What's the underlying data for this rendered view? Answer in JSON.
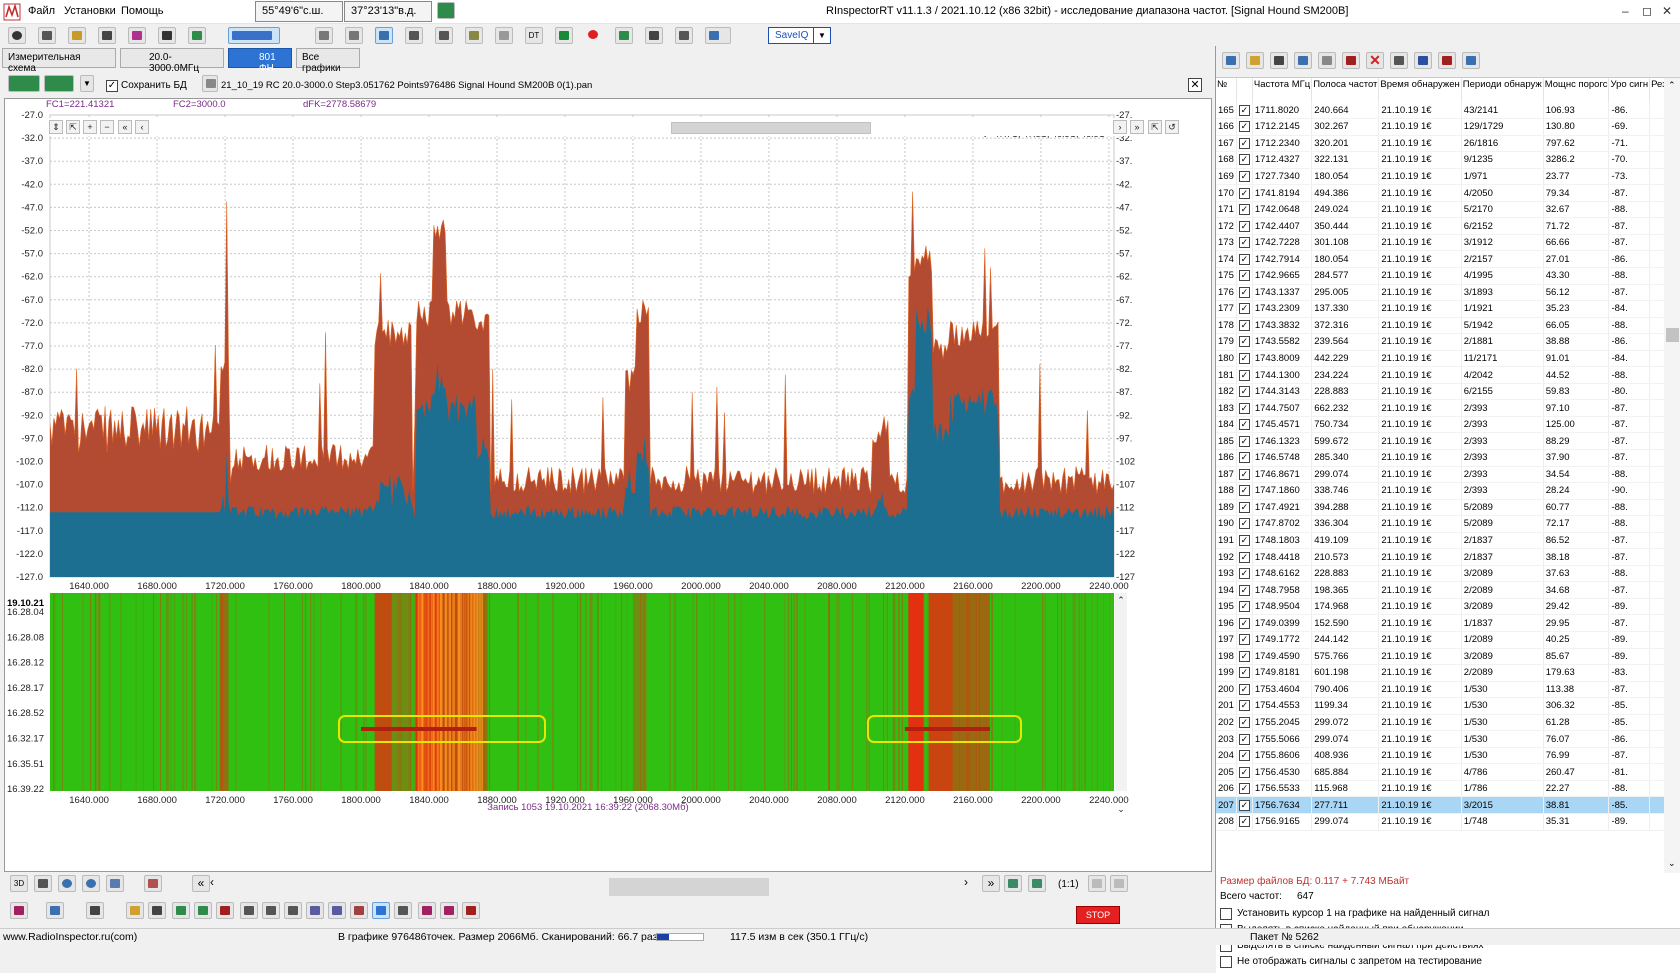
{
  "titlebar": {
    "title": "RInspectorRT v11.1.3 / 2021.10.12 (x86 32bit) - исследование диапазона частот. [Signal Hound SM200B]",
    "menu": [
      "Файл",
      "Установки",
      "Помощь"
    ],
    "lat": "55°49'6\"с.ш.",
    "lon": "37°23'13\"в.д."
  },
  "toolbar": {
    "saveiq_label": "SaveIQ"
  },
  "tabs": [
    {
      "label": "Измерительная схема"
    },
    {
      "label": "20.0-3000.0МГц"
    },
    {
      "label": "801 ФН"
    },
    {
      "label": "Все графики"
    }
  ],
  "filebar": {
    "save_db_label": "Сохранить БД",
    "filename": "21_10_19 RC 20.0-3000.0 Step3.051762 Points976486 Signal Hound SM200B 0(1).pan"
  },
  "spectrum": {
    "fc1": "FC1=221.41321",
    "fc2": "FC2=3000.0",
    "dfk": "dFK=2778.58679",
    "temperature": "t =47.7C, 47.8C, 46.5C, 46.8C",
    "y_ticks": [
      "-27.0",
      "-32.0",
      "-37.0",
      "-42.0",
      "-47.0",
      "-52.0",
      "-57.0",
      "-62.0",
      "-67.0",
      "-72.0",
      "-77.0",
      "-82.0",
      "-87.0",
      "-92.0",
      "-97.0",
      "-102.0",
      "-107.0",
      "-112.0",
      "-117.0",
      "-122.0",
      "-127.0"
    ],
    "y_ticks_right": [
      "-27.",
      "-32.",
      "-37.",
      "-42.",
      "-47.",
      "-52.",
      "-57.",
      "-62.",
      "-67.",
      "-72.",
      "-77.",
      "-82.",
      "-87.",
      "-92.",
      "-97.",
      "-102",
      "-107",
      "-112",
      "-117",
      "-122",
      "-127"
    ],
    "x_ticks": [
      "1640.000",
      "1680.000",
      "1720.000",
      "1760.000",
      "1800.000",
      "1840.000",
      "1880.000",
      "1920.000",
      "1960.000",
      "2000.000",
      "2040.000",
      "2080.000",
      "2120.000",
      "2160.000",
      "2200.000",
      "2240.000"
    ],
    "colors": {
      "peak": "#b34b32",
      "avg": "#1c6f91",
      "trace": "#e0641e"
    }
  },
  "waterfall": {
    "date": "19.10.21",
    "time_ticks": [
      "16.28.04",
      "16.28.08",
      "16.28.12",
      "16.28.17",
      "16.28.52",
      "16.32.17",
      "16.35.51",
      "16.39.22"
    ],
    "x_ticks": [
      "1640.000",
      "1680.000",
      "1720.000",
      "1760.000",
      "1800.000",
      "1840.000",
      "1880.000",
      "1920.000",
      "1960.000",
      "2000.000",
      "2040.000",
      "2080.000",
      "2120.000",
      "2160.000",
      "2200.000",
      "2240.000"
    ],
    "record": "Запись 1053 19.10.2021 16:39:22 (2068.30Мб)",
    "colors": {
      "bg": "#2fc012",
      "signal": "#e23010",
      "highlight": "#e9e600"
    }
  },
  "bottom": {
    "scale_label": "(1:1)",
    "stop_label": "STOP"
  },
  "status": {
    "site": "www.RadioInspector.ru(com)",
    "info": "В графике 976486точек.  Размер 2066Мб. Сканирований: 66.7 раз",
    "speed": "117.5 изм в сек (350.1 ГГц/с)",
    "packet": "Пакет № 5262"
  },
  "table": {
    "headers": [
      "№",
      "",
      "Частота МГц",
      "Полоса частот",
      "Время обнаружен",
      "Периоди обнаруж",
      "Мощнс порогс",
      "Уро сигн",
      "Результаты исследования сигн"
    ],
    "rows": [
      [
        "165",
        "1711.8020",
        "240.664",
        "21.10.19 1€",
        "43/2141",
        "106.93",
        "-86."
      ],
      [
        "166",
        "1712.2145",
        "302.267",
        "21.10.19 1€",
        "129/1729",
        "130.80",
        "-69."
      ],
      [
        "167",
        "1712.2340",
        "320.201",
        "21.10.19 1€",
        "26/1816",
        "797.62",
        "-71."
      ],
      [
        "168",
        "1712.4327",
        "322.131",
        "21.10.19 1€",
        "9/1235",
        "3286.2",
        "-70."
      ],
      [
        "169",
        "1727.7340",
        "180.054",
        "21.10.19 1€",
        "1/971",
        "23.77",
        "-73."
      ],
      [
        "170",
        "1741.8194",
        "494.386",
        "21.10.19 1€",
        "4/2050",
        "79.34",
        "-87."
      ],
      [
        "171",
        "1742.0648",
        "249.024",
        "21.10.19 1€",
        "5/2170",
        "32.67",
        "-88."
      ],
      [
        "172",
        "1742.4407",
        "350.444",
        "21.10.19 1€",
        "6/2152",
        "71.72",
        "-87."
      ],
      [
        "173",
        "1742.7228",
        "301.108",
        "21.10.19 1€",
        "3/1912",
        "66.66",
        "-87."
      ],
      [
        "174",
        "1742.7914",
        "180.054",
        "21.10.19 1€",
        "2/2157",
        "27.01",
        "-86."
      ],
      [
        "175",
        "1742.9665",
        "284.577",
        "21.10.19 1€",
        "4/1995",
        "43.30",
        "-88."
      ],
      [
        "176",
        "1743.1337",
        "295.005",
        "21.10.19 1€",
        "3/1893",
        "56.12",
        "-87."
      ],
      [
        "177",
        "1743.2309",
        "137.330",
        "21.10.19 1€",
        "1/1921",
        "35.23",
        "-84."
      ],
      [
        "178",
        "1743.3832",
        "372.316",
        "21.10.19 1€",
        "5/1942",
        "66.05",
        "-88."
      ],
      [
        "179",
        "1743.5582",
        "239.564",
        "21.10.19 1€",
        "2/1881",
        "38.88",
        "-86."
      ],
      [
        "180",
        "1743.8009",
        "442.229",
        "21.10.19 1€",
        "11/2171",
        "91.01",
        "-84."
      ],
      [
        "181",
        "1744.1300",
        "234.224",
        "21.10.19 1€",
        "4/2042",
        "44.52",
        "-88."
      ],
      [
        "182",
        "1744.3143",
        "228.883",
        "21.10.19 1€",
        "6/2155",
        "59.83",
        "-80."
      ],
      [
        "183",
        "1744.7507",
        "662.232",
        "21.10.19 1€",
        "2/393",
        "97.10",
        "-87."
      ],
      [
        "184",
        "1745.4571",
        "750.734",
        "21.10.19 1€",
        "2/393",
        "125.00",
        "-87."
      ],
      [
        "185",
        "1746.1323",
        "599.672",
        "21.10.19 1€",
        "2/393",
        "88.29",
        "-87."
      ],
      [
        "186",
        "1746.5748",
        "285.340",
        "21.10.19 1€",
        "2/393",
        "37.90",
        "-87."
      ],
      [
        "187",
        "1746.8671",
        "299.074",
        "21.10.19 1€",
        "2/393",
        "34.54",
        "-88."
      ],
      [
        "188",
        "1747.1860",
        "338.746",
        "21.10.19 1€",
        "2/393",
        "28.24",
        "-90."
      ],
      [
        "189",
        "1747.4921",
        "394.288",
        "21.10.19 1€",
        "5/2089",
        "60.77",
        "-88."
      ],
      [
        "190",
        "1747.8702",
        "336.304",
        "21.10.19 1€",
        "5/2089",
        "72.17",
        "-88."
      ],
      [
        "191",
        "1748.1803",
        "419.109",
        "21.10.19 1€",
        "2/1837",
        "86.52",
        "-87."
      ],
      [
        "192",
        "1748.4418",
        "210.573",
        "21.10.19 1€",
        "2/1837",
        "38.18",
        "-87."
      ],
      [
        "193",
        "1748.6162",
        "228.883",
        "21.10.19 1€",
        "3/2089",
        "37.63",
        "-88."
      ],
      [
        "194",
        "1748.7958",
        "198.365",
        "21.10.19 1€",
        "2/2089",
        "34.68",
        "-87."
      ],
      [
        "195",
        "1748.9504",
        "174.968",
        "21.10.19 1€",
        "3/2089",
        "29.42",
        "-89."
      ],
      [
        "196",
        "1749.0399",
        "152.590",
        "21.10.19 1€",
        "1/1837",
        "29.95",
        "-87."
      ],
      [
        "197",
        "1749.1772",
        "244.142",
        "21.10.19 1€",
        "1/2089",
        "40.25",
        "-89."
      ],
      [
        "198",
        "1749.4590",
        "575.766",
        "21.10.19 1€",
        "3/2089",
        "85.67",
        "-89."
      ],
      [
        "199",
        "1749.8181",
        "601.198",
        "21.10.19 1€",
        "2/2089",
        "179.63",
        "-83."
      ],
      [
        "200",
        "1753.4604",
        "790.406",
        "21.10.19 1€",
        "1/530",
        "113.38",
        "-87."
      ],
      [
        "201",
        "1754.4553",
        "1199.34",
        "21.10.19 1€",
        "1/530",
        "306.32",
        "-85."
      ],
      [
        "202",
        "1755.2045",
        "299.072",
        "21.10.19 1€",
        "1/530",
        "61.28",
        "-85."
      ],
      [
        "203",
        "1755.5066",
        "299.074",
        "21.10.19 1€",
        "1/530",
        "76.07",
        "-86."
      ],
      [
        "204",
        "1755.8606",
        "408.936",
        "21.10.19 1€",
        "1/530",
        "76.99",
        "-87."
      ],
      [
        "205",
        "1756.4530",
        "685.884",
        "21.10.19 1€",
        "4/786",
        "260.47",
        "-81."
      ],
      [
        "206",
        "1756.5533",
        "115.968",
        "21.10.19 1€",
        "1/786",
        "22.27",
        "-88."
      ],
      [
        "207",
        "1756.7634",
        "277.711",
        "21.10.19 1€",
        "3/2015",
        "38.81",
        "-85."
      ],
      [
        "208",
        "1756.9165",
        "299.074",
        "21.10.19 1€",
        "1/748",
        "35.31",
        "-89."
      ]
    ],
    "selected_index": 42
  },
  "right_footer": {
    "db_size": "Размер файлов БД: 0.117 + 7.743 МБайт",
    "total_label": "Всего частот:",
    "total_value": "647",
    "options": [
      "Установить курсор 1 на графике на найденный сигнал",
      "Выделять в списке найденный при обнаружении",
      "Выделять в списке найденный сигнал при действиях",
      "Не отображать сигналы с запретом на тестирование"
    ]
  }
}
